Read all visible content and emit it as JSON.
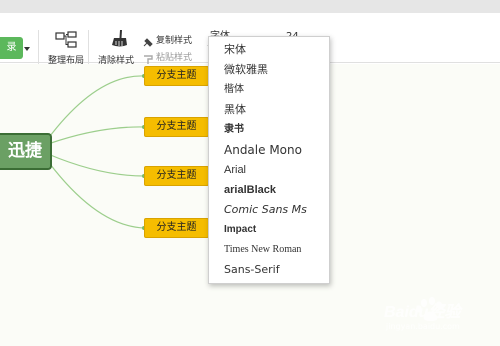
{
  "toolbar": {
    "theme_button_label": "录",
    "layout_label": "整理布局",
    "clear_style_label": "清除样式",
    "copy_style_label": "复制样式",
    "paste_style_label": "粘贴样式",
    "font_select_value": "字体",
    "size_select_value": "24"
  },
  "mindmap": {
    "root_label": "迅捷",
    "topics": [
      "分支主题",
      "分支主题",
      "分支主题",
      "分支主题"
    ]
  },
  "font_menu": {
    "items": [
      "宋体",
      "微软雅黑",
      "楷体",
      "黑体",
      "隶书",
      "Andale Mono",
      "Arial",
      "arialBlack",
      "Comic Sans Ms",
      "Impact",
      "Times New Roman",
      "Sans-Serif"
    ]
  },
  "watermark": {
    "text": "Baidu经验",
    "url": "jingyan.baidu.com"
  },
  "colors": {
    "root_fill": "#6ba064",
    "topic_fill": "#f5bd00",
    "connector": "#9cce8c",
    "button_green": "#5cb85c"
  }
}
